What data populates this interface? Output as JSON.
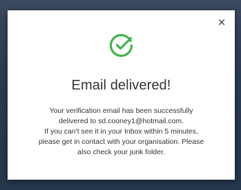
{
  "dialog": {
    "close_label": "×",
    "icon": "check-circle-icon",
    "accent_color": "#3cb54a",
    "title": "Email delivered!",
    "message_lines": [
      "Your verification email has been successfully",
      "delivered to sd.cooney1@hotmail.com.",
      "If you can't see it in your Inbox within 5 minutes,",
      "please get in contact with your organisation. Please",
      "also check your junk folder."
    ]
  }
}
